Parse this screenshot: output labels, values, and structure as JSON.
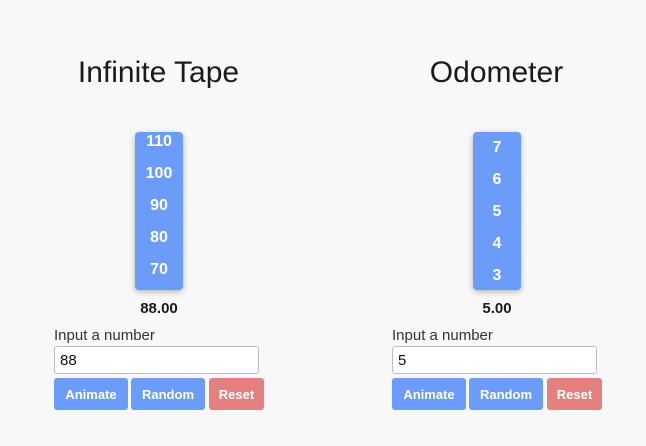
{
  "infinite_tape": {
    "title": "Infinite Tape",
    "tape_ticks": [
      "110",
      "100",
      "90",
      "80",
      "70"
    ],
    "value": "88.00",
    "input_label": "Input a number",
    "input_value": "88",
    "buttons": {
      "animate": "Animate",
      "random": "Random",
      "reset": "Reset"
    }
  },
  "odometer": {
    "title": "Odometer",
    "tape_ticks": [
      "7",
      "6",
      "5",
      "4",
      "3"
    ],
    "value": "5.00",
    "input_label": "Input a number",
    "input_value": "5",
    "buttons": {
      "animate": "Animate",
      "random": "Random",
      "reset": "Reset"
    }
  },
  "colors": {
    "tape": "#6b9cfa",
    "button_primary": "#6b9cfa",
    "button_reset": "#e58080",
    "background": "#f8f8f8"
  }
}
